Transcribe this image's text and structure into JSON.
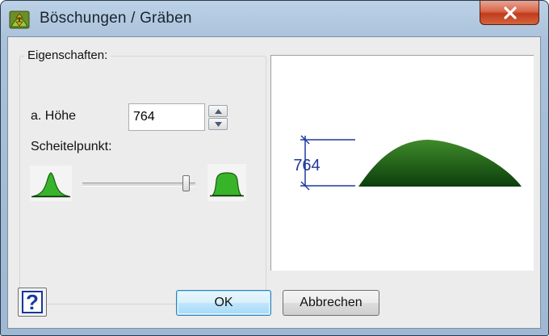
{
  "window": {
    "title": "Böschungen / Gräben",
    "close_glyph": "✕"
  },
  "properties": {
    "group_title": "Eigenschaften:",
    "height_label": "a. Höhe",
    "height_value": "764",
    "apex_label": "Scheitelpunkt:",
    "apex_slider_fraction": 0.95
  },
  "preview": {
    "dimension_text": "764",
    "dimension_color": "#1f3a9e",
    "mound_color_top": "#3f8a2a",
    "mound_color_bottom": "#0c3f0c"
  },
  "buttons": {
    "help_glyph": "?",
    "ok_label": "OK",
    "cancel_label": "Abbrechen"
  },
  "icons": {
    "app": "mound-app-icon",
    "peak_narrow": "narrow-peak-icon",
    "peak_wide": "wide-peak-icon"
  },
  "colors": {
    "icon_green": "#38b42a",
    "help_blue": "#17379a"
  }
}
